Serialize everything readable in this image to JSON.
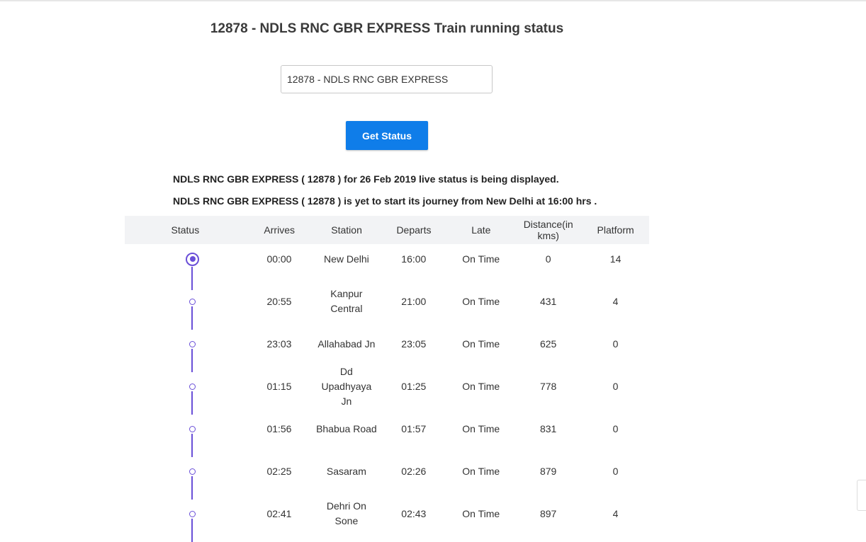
{
  "page": {
    "title": "12878 - NDLS RNC GBR EXPRESS Train running status"
  },
  "search": {
    "value": "12878 - NDLS RNC GBR EXPRESS",
    "button_label": "Get Status"
  },
  "messages": {
    "line1": "NDLS RNC GBR EXPRESS ( 12878 ) for 26 Feb 2019 live status is being displayed.",
    "line2": "NDLS RNC GBR EXPRESS ( 12878 ) is yet to start its journey from New Delhi at 16:00 hrs ."
  },
  "table": {
    "headers": {
      "status": "Status",
      "arrives": "Arrives",
      "station": "Station",
      "departs": "Departs",
      "late": "Late",
      "distance": "Distance(in kms)",
      "platform": "Platform"
    },
    "rows": [
      {
        "arrives": "00:00",
        "station": "New Delhi",
        "departs": "16:00",
        "late": "On Time",
        "distance": "0",
        "platform": "14",
        "current": true
      },
      {
        "arrives": "20:55",
        "station": "Kanpur Central",
        "departs": "21:00",
        "late": "On Time",
        "distance": "431",
        "platform": "4",
        "current": false
      },
      {
        "arrives": "23:03",
        "station": "Allahabad Jn",
        "departs": "23:05",
        "late": "On Time",
        "distance": "625",
        "platform": "0",
        "current": false
      },
      {
        "arrives": "01:15",
        "station": "Dd Upadhyaya Jn",
        "departs": "01:25",
        "late": "On Time",
        "distance": "778",
        "platform": "0",
        "current": false
      },
      {
        "arrives": "01:56",
        "station": "Bhabua Road",
        "departs": "01:57",
        "late": "On Time",
        "distance": "831",
        "platform": "0",
        "current": false
      },
      {
        "arrives": "02:25",
        "station": "Sasaram",
        "departs": "02:26",
        "late": "On Time",
        "distance": "879",
        "platform": "0",
        "current": false
      },
      {
        "arrives": "02:41",
        "station": "Dehri On Sone",
        "departs": "02:43",
        "late": "On Time",
        "distance": "897",
        "platform": "4",
        "current": false
      }
    ]
  },
  "colors": {
    "accent": "#0f7de9",
    "timeline": "#6a4fd8",
    "header_bg": "#f2f3f5"
  }
}
